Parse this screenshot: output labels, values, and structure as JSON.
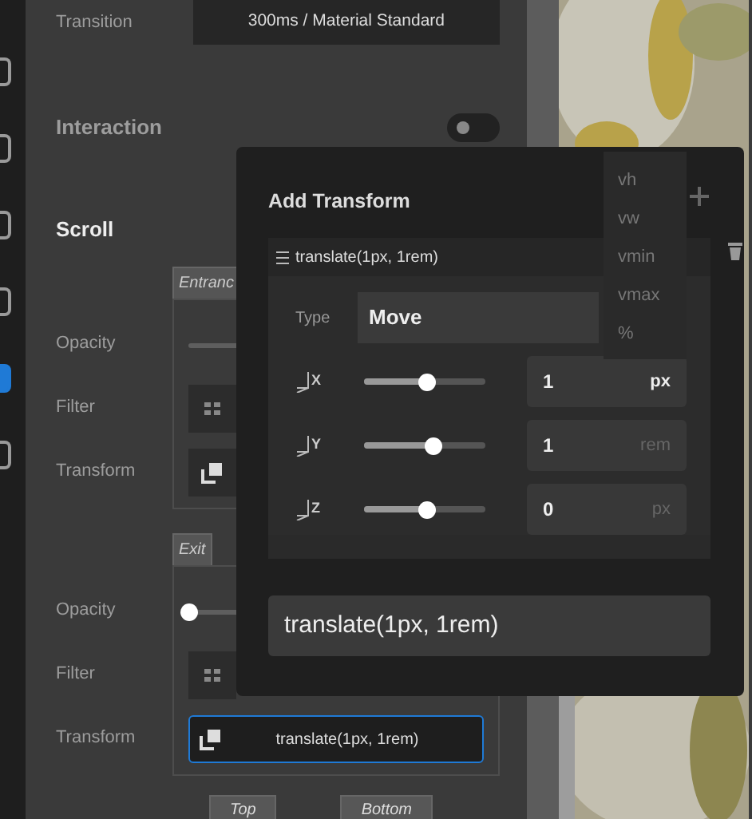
{
  "sidebar": {
    "items": [
      {
        "selected": false
      },
      {
        "selected": false
      },
      {
        "selected": false
      },
      {
        "selected": false
      },
      {
        "selected": true
      },
      {
        "selected": false
      }
    ]
  },
  "settings": {
    "transition": {
      "label": "Transition",
      "value": "300ms / Material Standard"
    },
    "interaction": {
      "label": "Interaction",
      "on": false
    },
    "scroll": {
      "label": "Scroll",
      "groups": [
        {
          "tab": "Entranc",
          "rows": [
            {
              "label": "Opacity",
              "kind": "slider"
            },
            {
              "label": "Filter",
              "kind": "filter"
            },
            {
              "label": "Transform",
              "kind": "transform"
            }
          ]
        },
        {
          "tab": "Exit",
          "rows": [
            {
              "label": "Opacity",
              "kind": "slider",
              "level": 0
            },
            {
              "label": "Filter",
              "kind": "filter"
            },
            {
              "label": "Transform",
              "kind": "field",
              "value": "translate(1px, 1rem)"
            }
          ]
        }
      ],
      "positions": [
        "Top",
        "Bottom"
      ]
    }
  },
  "dialog": {
    "title": "Add Transform",
    "transforms": [
      {
        "label": "translate(1px, 1rem)",
        "type_label": "Type",
        "type": "Move",
        "axes": [
          {
            "axis": "X",
            "level": 0.51,
            "value": "1",
            "unit": "px",
            "focused": true
          },
          {
            "axis": "Y",
            "level": 0.56,
            "value": "1",
            "unit": "rem",
            "focused": false
          },
          {
            "axis": "Z",
            "level": 0.51,
            "value": "0",
            "unit": "px",
            "focused": false
          }
        ]
      }
    ],
    "result": "translate(1px, 1rem)",
    "unit_menu": [
      "vh",
      "vw",
      "vmin",
      "vmax",
      "%"
    ]
  }
}
